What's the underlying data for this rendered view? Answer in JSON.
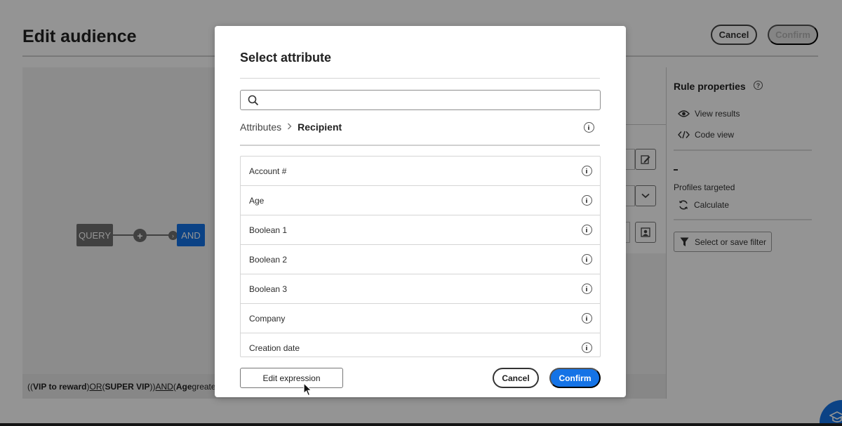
{
  "page": {
    "title": "Edit audience",
    "cancel_label": "Cancel",
    "confirm_label": "Confirm"
  },
  "canvas": {
    "query_label": "QUERY",
    "and_label": "AND"
  },
  "expression": {
    "p1": "((",
    "vip_reward": "VIP to reward",
    "p2": ") ",
    "or": "OR",
    "p3": " (",
    "super_vip": "SUPER VIP",
    "p4": ")) ",
    "and": "AND",
    "p5": " (",
    "age": "Age",
    "p6": " greate"
  },
  "sidebar": {
    "title": "Rule properties",
    "view_results": "View results",
    "code_view": "Code view",
    "dash": "-",
    "profiles_targeted": "Profiles targeted",
    "calculate": "Calculate",
    "select_filter": "Select or save filter"
  },
  "dialog": {
    "title": "Select attribute",
    "search": {
      "value": "",
      "placeholder": ""
    },
    "breadcrumb": {
      "root": "Attributes",
      "separator": ">",
      "current": "Recipient"
    },
    "attributes": [
      "Account #",
      "Age",
      "Boolean 1",
      "Boolean 2",
      "Boolean 3",
      "Company",
      "Creation date"
    ],
    "edit_expression_label": "Edit expression",
    "cancel_label": "Cancel",
    "confirm_label": "Confirm"
  },
  "colors": {
    "accent": "#1473e6",
    "node_gray": "#707070"
  }
}
